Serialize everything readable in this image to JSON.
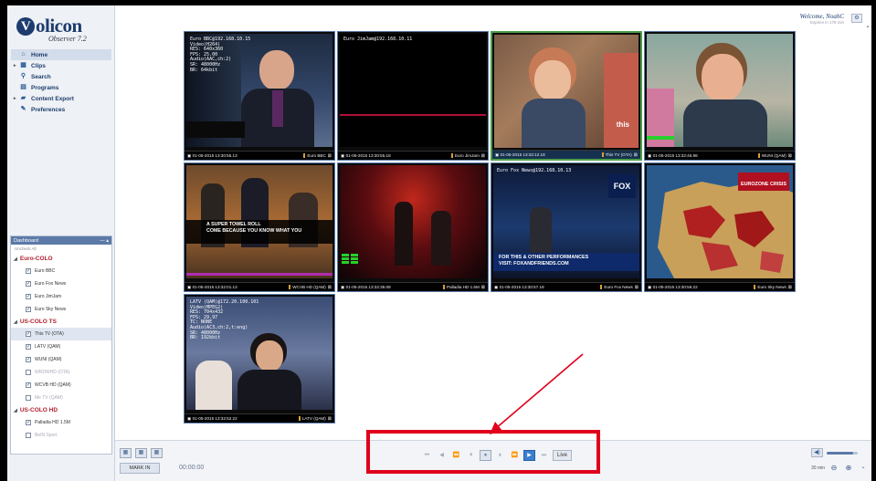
{
  "app": {
    "brand": "olicon",
    "brand_initial": "V",
    "subtitle": "Observer 7.2"
  },
  "user": {
    "welcome": "Welcome, NoahC",
    "expires": "Expires in 178 min"
  },
  "nav": [
    {
      "label": "Home",
      "icon": "home-icon",
      "active": true
    },
    {
      "label": "Clips",
      "icon": "film-icon"
    },
    {
      "label": "Search",
      "icon": "search-icon"
    },
    {
      "label": "Programs",
      "icon": "programs-icon"
    },
    {
      "label": "Content Export",
      "icon": "export-icon"
    },
    {
      "label": "Preferences",
      "icon": "wrench-icon"
    }
  ],
  "dashboard": {
    "title": "Dashboard",
    "subtitle": "Uncheck All",
    "groups": [
      {
        "name": "Euro-COLO",
        "channels": [
          {
            "label": "Euro BBC",
            "checked": true
          },
          {
            "label": "Euro Fox News",
            "checked": true
          },
          {
            "label": "Euro JimJam",
            "checked": true
          },
          {
            "label": "Euro Sky News",
            "checked": true
          }
        ]
      },
      {
        "name": "US-COLO TS",
        "channels": [
          {
            "label": "This TV (OTA)",
            "checked": true,
            "selected": true
          },
          {
            "label": "LATV (QAM)",
            "checked": true
          },
          {
            "label": "WUNI (QAM)",
            "checked": true
          },
          {
            "label": "WRDWHD (OTA)",
            "checked": false,
            "disabled": true
          },
          {
            "label": "WCVB HD (QAM)",
            "checked": true
          },
          {
            "label": "Me TV (QAM)",
            "checked": false,
            "disabled": true
          }
        ]
      },
      {
        "name": "US-COLO HD",
        "channels": [
          {
            "label": "Palladia HD 1.5M",
            "checked": true
          },
          {
            "label": "BeIN Sport",
            "checked": false,
            "disabled": true
          }
        ]
      }
    ]
  },
  "tiles": [
    {
      "time": "01-05-2015 13:30:55.13",
      "channel": "Euro BBC",
      "osd": "Euro BBC@192.168.10.15\nVideo(H264)\nRES: 640x360\nFPS: 25.00\nAudio(AAC,ch:2)\nSR: 48000Hz\nBR: 64kbit"
    },
    {
      "time": "01-05-2015 13:30:55.18",
      "channel": "Euro JimJam",
      "osd": "Euro JimJam@192.168.10.11"
    },
    {
      "time": "01-05-2015 13:32:12.18",
      "channel": "This TV (OTA)",
      "caption": "this",
      "selected": true
    },
    {
      "time": "01-05-2015 13:32:46.98",
      "channel": "WUNI (QAM)"
    },
    {
      "time": "01-05-2015 13:32:01.13",
      "channel": "WCVB HD (QAM)",
      "caption": "A SUPER TOWEL ROLL\nCOME BECAUSE YOU KNOW WHAT YOU"
    },
    {
      "time": "01-05-2015 13:32:36.08",
      "channel": "Palladia HD 1.5M"
    },
    {
      "time": "01-05-2015 13:30:57.18",
      "channel": "Euro Fox News",
      "osd": "Euro Fox News@192.168.10.13",
      "caption": "FOR THIS & OTHER PERFORMANCES\nVISIT: FOXANDFRIENDS.COM"
    },
    {
      "time": "01-05-2015 13:30:56.22",
      "channel": "Euro Sky News",
      "caption": "EUROZONE CRISIS"
    },
    {
      "time": "01-05-2015 13:32:52.22",
      "channel": "LATV (QAM)",
      "osd": "LATV (QAM)@172.20.100.101\nVideo(MPEG2)\nRES: 704x432\nFPS: 29.97\nTC: NONE\nAudio(AC3,ch:2,t:eng)\nSR: 48000Hz\nBR: 192kbit"
    }
  ],
  "bottom": {
    "mark_in": "MARK IN",
    "timecode": "00:00:00",
    "live": "Live",
    "zoom_level": "30 min",
    "volume": 0.85
  },
  "colors": {
    "accent": "#1d3c6e",
    "highlight": "#e0001b",
    "selected_tile": "#4e9e4a"
  }
}
